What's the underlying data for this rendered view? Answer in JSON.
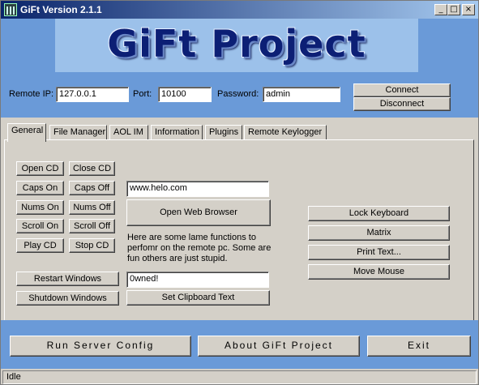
{
  "window": {
    "title": "GiFt Version 2.1.1",
    "min": "_",
    "max": "□",
    "close": "×"
  },
  "banner": {
    "logo_text": "GiFt Project"
  },
  "connection": {
    "ip_label": "Remote IP:",
    "ip_value": "127.0.0.1",
    "port_label": "Port:",
    "port_value": "10100",
    "password_label": "Password:",
    "password_value": "admin",
    "connect": "Connect",
    "disconnect": "Disconnect"
  },
  "tabs": [
    "General",
    "File Manager",
    "AOL IM",
    "Information",
    "Plugins",
    "Remote Keylogger"
  ],
  "general": {
    "open_cd": "Open CD",
    "close_cd": "Close CD",
    "caps_on": "Caps On",
    "caps_off": "Caps Off",
    "nums_on": "Nums On",
    "nums_off": "Nums Off",
    "scroll_on": "Scroll On",
    "scroll_off": "Scroll Off",
    "play_cd": "Play CD",
    "stop_cd": "Stop CD",
    "restart": "Restart Windows",
    "shutdown": "Shutdown Windows",
    "url_value": "www.helo.com",
    "open_browser": "Open Web Browser",
    "description": "Here are some lame functions to perfomr on the remote pc. Some are fun others are just stupid.",
    "clip_value": "0wned!",
    "set_clip": "Set Clipboard Text",
    "lock_keyboard": "Lock Keyboard",
    "matrix": "Matrix",
    "print_text": "Print Text...",
    "move_mouse": "Move Mouse"
  },
  "footer": {
    "run_config": "Run Server Config",
    "about": "About GiFt Project",
    "exit": "Exit"
  },
  "status": {
    "text": "Idle"
  }
}
